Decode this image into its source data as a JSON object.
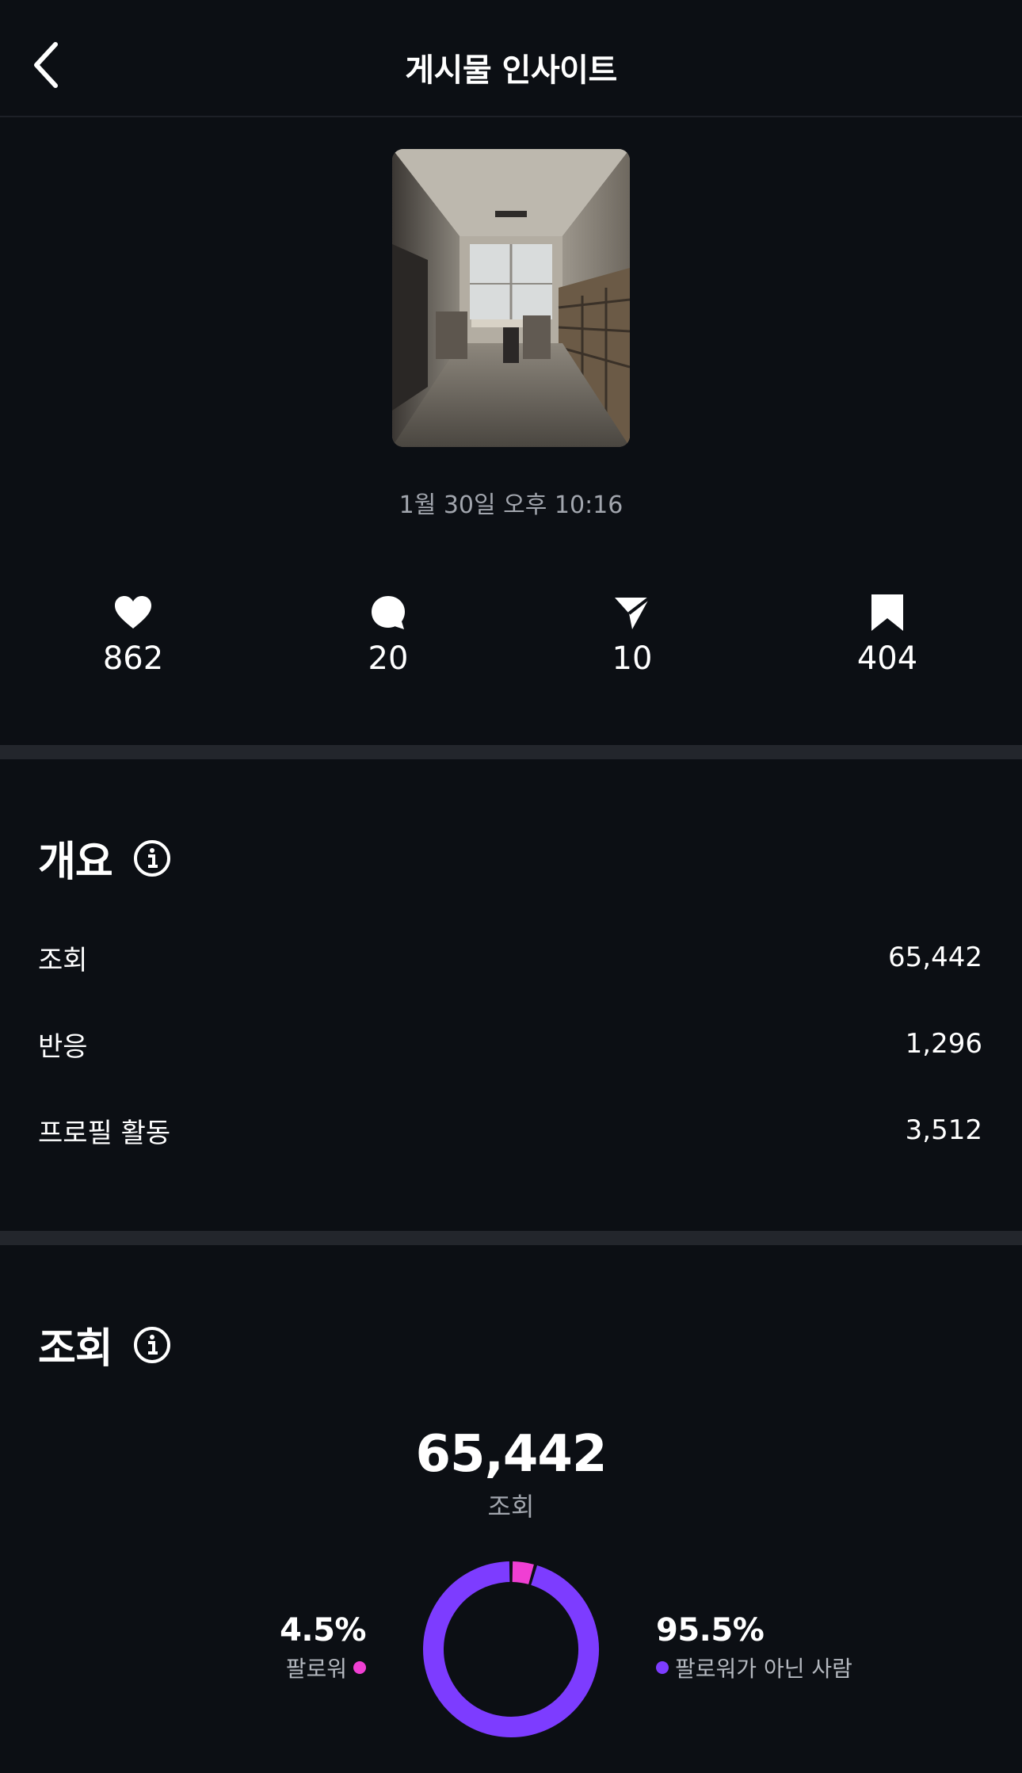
{
  "header": {
    "title": "게시물 인사이트",
    "back_icon": "chevron-left-icon"
  },
  "post": {
    "thumbnail": "room-photo",
    "date": "1월 30일 오후 10:16"
  },
  "stats": [
    {
      "icon": "heart-icon",
      "value": "862"
    },
    {
      "icon": "comment-icon",
      "value": "20"
    },
    {
      "icon": "send-icon",
      "value": "10"
    },
    {
      "icon": "bookmark-icon",
      "value": "404"
    }
  ],
  "overview": {
    "title": "개요",
    "rows": [
      {
        "label": "조회",
        "value": "65,442"
      },
      {
        "label": "반응",
        "value": "1,296"
      },
      {
        "label": "프로필 활동",
        "value": "3,512"
      }
    ]
  },
  "views": {
    "title": "조회",
    "total": "65,442",
    "total_label": "조회",
    "followers": {
      "pct": "4.5%",
      "label": "팔로워",
      "color": "#f03fd3"
    },
    "non_followers": {
      "pct": "95.5%",
      "label": "팔로워가 아닌 사람",
      "color": "#7d3cff"
    }
  },
  "chart_data": {
    "type": "pie",
    "categories": [
      "팔로워",
      "팔로워가 아닌 사람"
    ],
    "values": [
      4.5,
      95.5
    ]
  },
  "colors": {
    "background": "#0c0f14",
    "divider": "#23262c",
    "muted_text": "#a2a6ae"
  }
}
